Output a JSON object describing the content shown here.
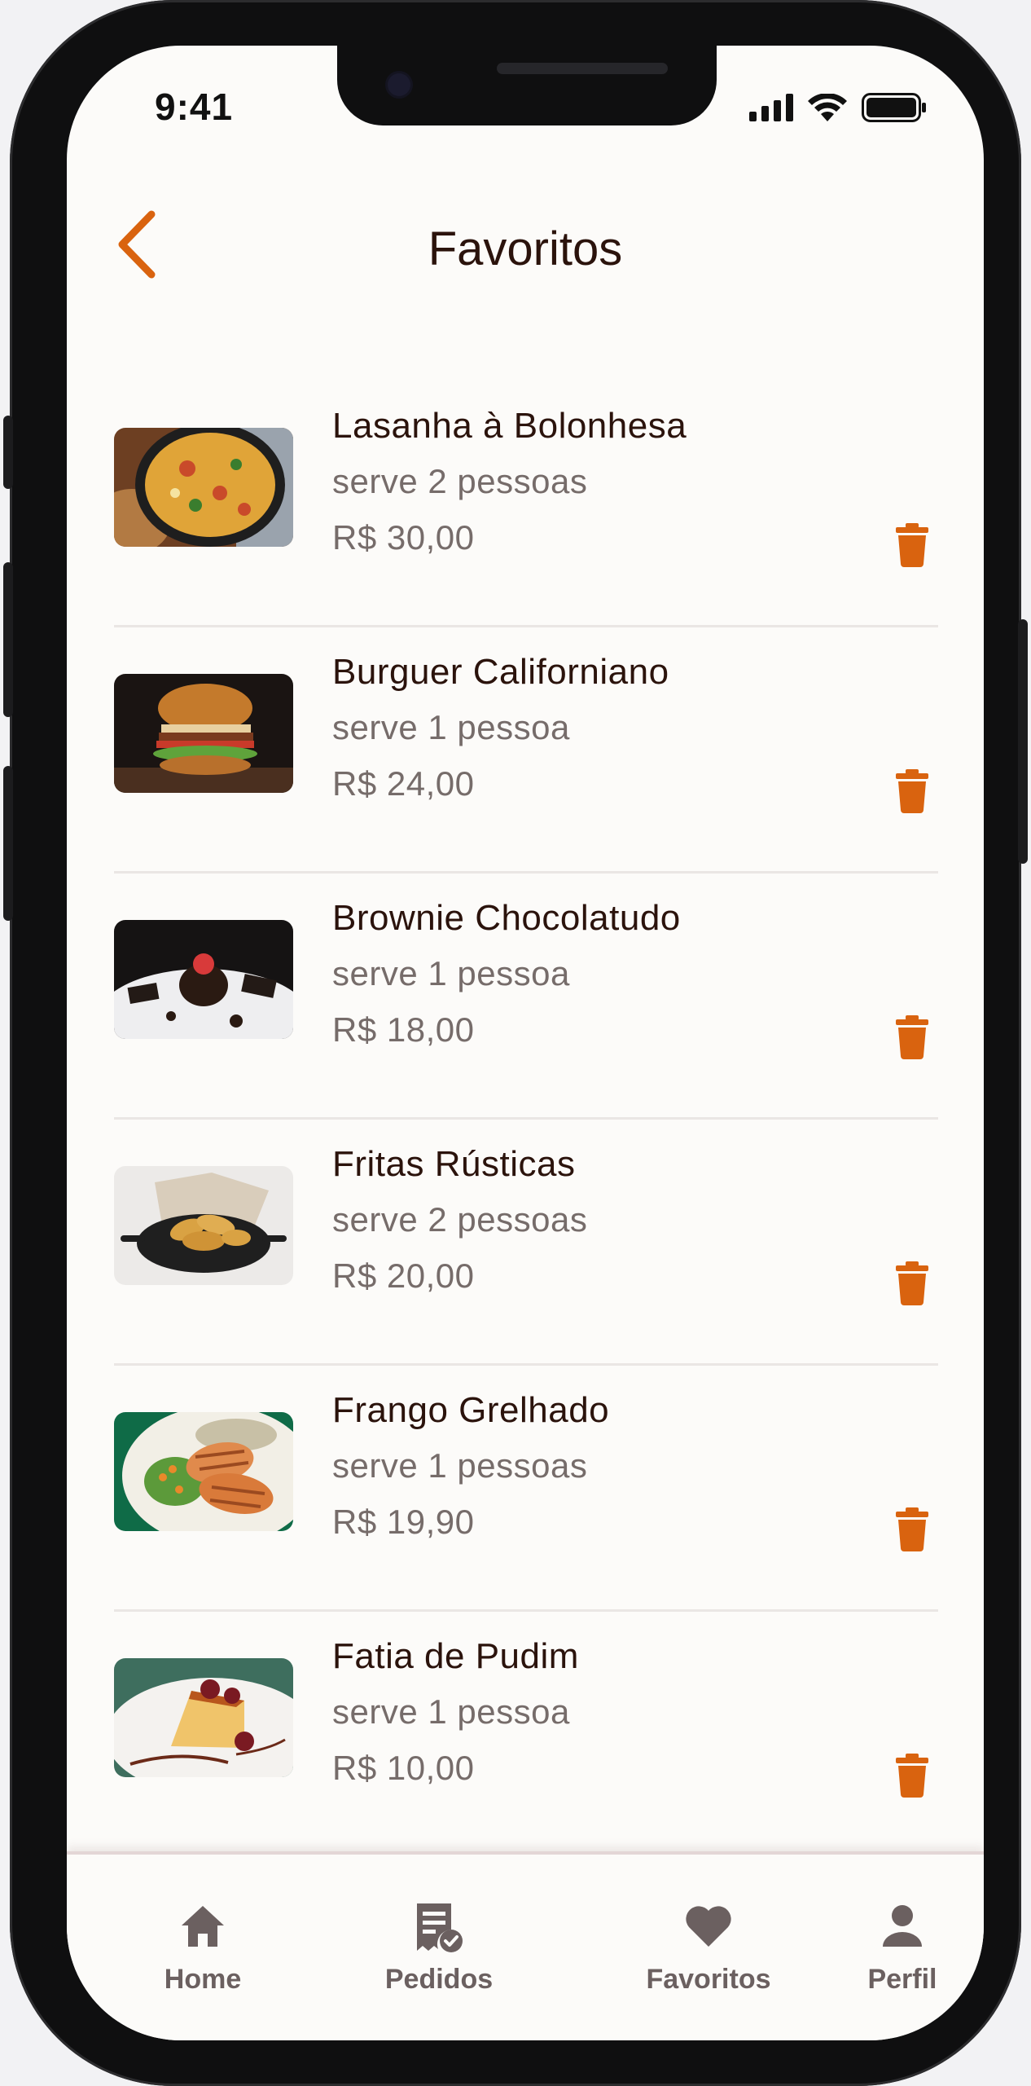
{
  "status_bar": {
    "time": "9:41"
  },
  "header": {
    "title": "Favoritos"
  },
  "colors": {
    "accent": "#d9630f",
    "title": "#2b130c",
    "muted": "#766c6a",
    "tab": "#6b6060"
  },
  "items": [
    {
      "name": "Lasanha à Bolonhesa",
      "serves": "serve 2 pessoas",
      "price": "R$ 30,00"
    },
    {
      "name": "Burguer Californiano",
      "serves": "serve 1 pessoa",
      "price": "R$ 24,00"
    },
    {
      "name": "Brownie Chocolatudo",
      "serves": "serve 1 pessoa",
      "price": "R$ 18,00"
    },
    {
      "name": "Fritas Rústicas",
      "serves": "serve 2 pessoas",
      "price": "R$ 20,00"
    },
    {
      "name": "Frango Grelhado",
      "serves": "serve 1 pessoas",
      "price": "R$ 19,90"
    },
    {
      "name": "Fatia de Pudim",
      "serves": "serve 1 pessoa",
      "price": "R$ 10,00"
    }
  ],
  "tabbar": {
    "home": "Home",
    "orders": "Pedidos",
    "favorites": "Favoritos",
    "profile": "Perfil"
  }
}
